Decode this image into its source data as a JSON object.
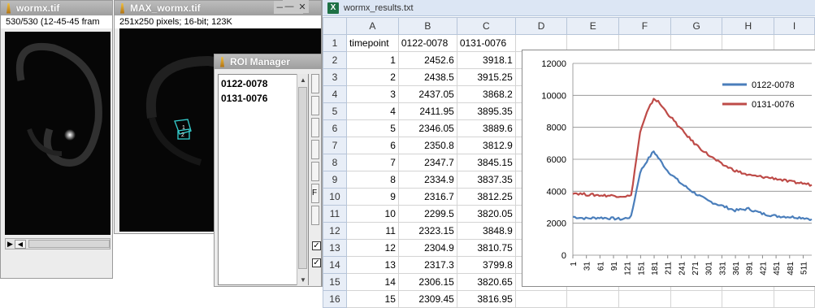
{
  "win_image": {
    "title": "wormx.tif",
    "info": "530/530 (12-45-45 fram"
  },
  "win_max": {
    "title": "MAX_wormx.tif",
    "info": "251x250 pixels; 16-bit; 123K",
    "roi_labels": [
      "1",
      "2"
    ]
  },
  "roi_manager": {
    "title": "ROI Manager",
    "items": [
      "0122-0078",
      "0131-0076"
    ],
    "checkbox_mark": "✓",
    "button_stub": "F"
  },
  "excel": {
    "title": "wormx_results.txt",
    "icon_letter": "X",
    "columns": [
      "A",
      "B",
      "C",
      "D",
      "E",
      "F",
      "G",
      "H",
      "I"
    ],
    "rows": [
      {
        "n": "1",
        "cells": [
          "timepoint",
          "0122-0078",
          "0131-0076"
        ]
      },
      {
        "n": "2",
        "cells": [
          "1",
          "2452.6",
          "3918.1"
        ]
      },
      {
        "n": "3",
        "cells": [
          "2",
          "2438.5",
          "3915.25"
        ]
      },
      {
        "n": "4",
        "cells": [
          "3",
          "2437.05",
          "3868.2"
        ]
      },
      {
        "n": "5",
        "cells": [
          "4",
          "2411.95",
          "3895.35"
        ]
      },
      {
        "n": "6",
        "cells": [
          "5",
          "2346.05",
          "3889.6"
        ]
      },
      {
        "n": "7",
        "cells": [
          "6",
          "2350.8",
          "3812.9"
        ]
      },
      {
        "n": "8",
        "cells": [
          "7",
          "2347.7",
          "3845.15"
        ]
      },
      {
        "n": "9",
        "cells": [
          "8",
          "2334.9",
          "3837.35"
        ]
      },
      {
        "n": "10",
        "cells": [
          "9",
          "2316.7",
          "3812.25"
        ]
      },
      {
        "n": "11",
        "cells": [
          "10",
          "2299.5",
          "3820.05"
        ]
      },
      {
        "n": "12",
        "cells": [
          "11",
          "2323.15",
          "3848.9"
        ]
      },
      {
        "n": "13",
        "cells": [
          "12",
          "2304.9",
          "3810.75"
        ]
      },
      {
        "n": "14",
        "cells": [
          "13",
          "2317.3",
          "3799.8"
        ]
      },
      {
        "n": "15",
        "cells": [
          "14",
          "2306.15",
          "3820.65"
        ]
      },
      {
        "n": "16",
        "cells": [
          "15",
          "2309.45",
          "3816.95"
        ]
      }
    ]
  },
  "chart_data": {
    "type": "line",
    "ylim": [
      0,
      12000
    ],
    "yticks": [
      0,
      2000,
      4000,
      6000,
      8000,
      10000,
      12000
    ],
    "xtick_labels": [
      "1",
      "31",
      "61",
      "91",
      "121",
      "151",
      "181",
      "211",
      "241",
      "271",
      "301",
      "331",
      "361",
      "391",
      "421",
      "451",
      "481",
      "511"
    ],
    "xlim": [
      1,
      530
    ],
    "series": [
      {
        "name": "0122-0078",
        "color": "#4a7ebb",
        "x": [
          1,
          30,
          60,
          90,
          110,
          130,
          150,
          165,
          180,
          190,
          210,
          240,
          270,
          300,
          330,
          360,
          390,
          420,
          450,
          480,
          510,
          530
        ],
        "y": [
          2400,
          2300,
          2350,
          2300,
          2250,
          2400,
          5200,
          5900,
          6500,
          6100,
          5300,
          4500,
          3900,
          3400,
          3100,
          2800,
          2900,
          2600,
          2450,
          2400,
          2350,
          2250
        ]
      },
      {
        "name": "0131-0076",
        "color": "#be4b48",
        "x": [
          1,
          30,
          60,
          90,
          110,
          130,
          150,
          165,
          180,
          190,
          210,
          240,
          270,
          300,
          330,
          360,
          390,
          420,
          450,
          480,
          510,
          530
        ],
        "y": [
          3900,
          3800,
          3750,
          3720,
          3700,
          3700,
          7700,
          8900,
          9800,
          9600,
          8900,
          7900,
          7000,
          6300,
          5700,
          5300,
          5000,
          4900,
          4800,
          4600,
          4500,
          4400
        ]
      }
    ],
    "legend_position": "top-right"
  }
}
